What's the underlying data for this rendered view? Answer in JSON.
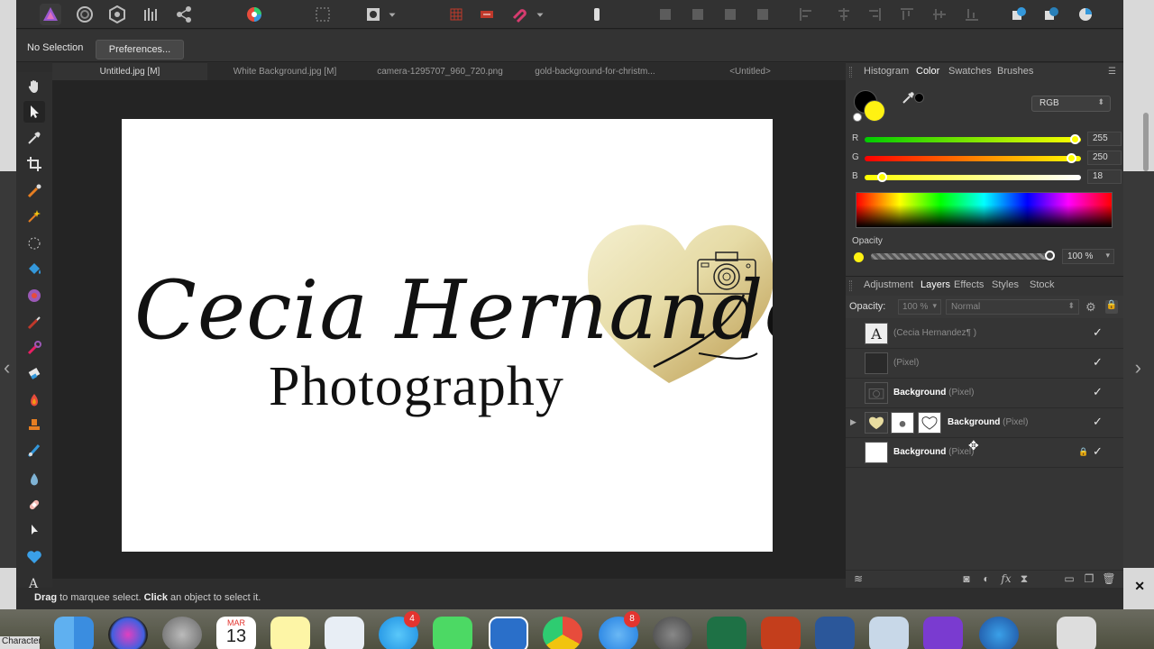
{
  "context_bar": {
    "selection_status": "No Selection",
    "preferences_button": "Preferences..."
  },
  "document_tabs": [
    {
      "label": "Untitled.jpg [M]",
      "active": true
    },
    {
      "label": "White Background.jpg [M]",
      "active": false
    },
    {
      "label": "camera-1295707_960_720.png",
      "active": false
    },
    {
      "label": "gold-background-for-christm...",
      "active": false
    },
    {
      "label": "<Untitled>",
      "active": false
    }
  ],
  "canvas": {
    "script_text": "Cecia Hernandez",
    "sub_text": "Photography"
  },
  "color_panel": {
    "tabs": [
      "Histogram",
      "Color",
      "Swatches",
      "Brushes"
    ],
    "active_tab": "Color",
    "mode": "RGB",
    "channels": [
      {
        "label": "R",
        "value": "255",
        "level": 1.0
      },
      {
        "label": "G",
        "value": "250",
        "level": 0.98
      },
      {
        "label": "B",
        "value": "18",
        "level": 0.07
      }
    ],
    "opacity_label": "Opacity",
    "opacity_value": "100 %",
    "fill_color": "#fff212"
  },
  "layers_panel": {
    "tabs": [
      "Adjustment",
      "Layers",
      "Effects",
      "Styles",
      "Stock"
    ],
    "active_tab": "Layers",
    "opacity_label": "Opacity:",
    "opacity_value": "100 %",
    "blend_mode": "Normal",
    "layers": [
      {
        "name": "",
        "type": "(Cecia Hernandez¶        )",
        "thumb": "text"
      },
      {
        "name": "",
        "type": "(Pixel)",
        "thumb": "dark"
      },
      {
        "name": "Background",
        "type": "(Pixel)",
        "thumb": "camera"
      },
      {
        "name": "Background",
        "type": "(Pixel)",
        "thumb": "heart"
      },
      {
        "name": "Background",
        "type": "(Pixel)",
        "thumb": "white"
      }
    ]
  },
  "status_bar": {
    "drag_word": "Drag",
    "drag_rest": " to marquee select. ",
    "click_word": "Click",
    "click_rest": " an object to select it."
  },
  "dock": {
    "character_label": "Character",
    "calendar_month": "MAR",
    "calendar_day": "13",
    "messages_badge": "4",
    "appstore_badge": "8"
  }
}
